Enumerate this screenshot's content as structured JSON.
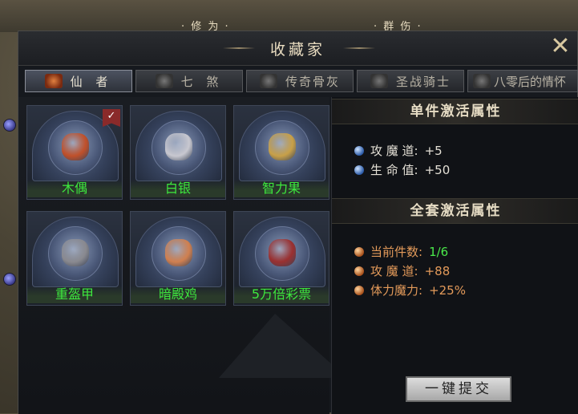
{
  "background": {
    "labels": [
      "· 修 为 ·",
      "· 群 伤 ·"
    ]
  },
  "window": {
    "title": "收藏家",
    "close_icon": "crossed-swords-close"
  },
  "tabs": [
    {
      "label": "仙 者",
      "active": true
    },
    {
      "label": "七 煞",
      "active": false
    },
    {
      "label": "传奇骨灰",
      "active": false
    },
    {
      "label": "圣战骑士",
      "active": false
    },
    {
      "label": "八零后的情怀",
      "active": false
    }
  ],
  "items": [
    {
      "name": "木偶",
      "collected": true,
      "art_color": "#c0502a"
    },
    {
      "name": "白银",
      "collected": false,
      "art_color": "#c8c8d0"
    },
    {
      "name": "智力果",
      "collected": false,
      "art_color": "#c8a048"
    },
    {
      "name": "重盔甲",
      "collected": false,
      "art_color": "#8a8a90"
    },
    {
      "name": "暗殿鸡",
      "collected": false,
      "art_color": "#d08050"
    },
    {
      "name": "5万倍彩票",
      "collected": false,
      "art_color": "#9a3030"
    }
  ],
  "single": {
    "header": "单件激活属性",
    "attrs": [
      {
        "label": "攻 魔 道:",
        "value": "+5"
      },
      {
        "label": "生 命 值:",
        "value": "+50"
      }
    ]
  },
  "set": {
    "header": "全套激活属性",
    "count_label": "当前件数:",
    "count_value": "1/6",
    "attrs": [
      {
        "label": "攻 魔 道:",
        "value": "+88"
      },
      {
        "label": "体力魔力:",
        "value": "+25%"
      }
    ]
  },
  "submit_label": "一键提交"
}
